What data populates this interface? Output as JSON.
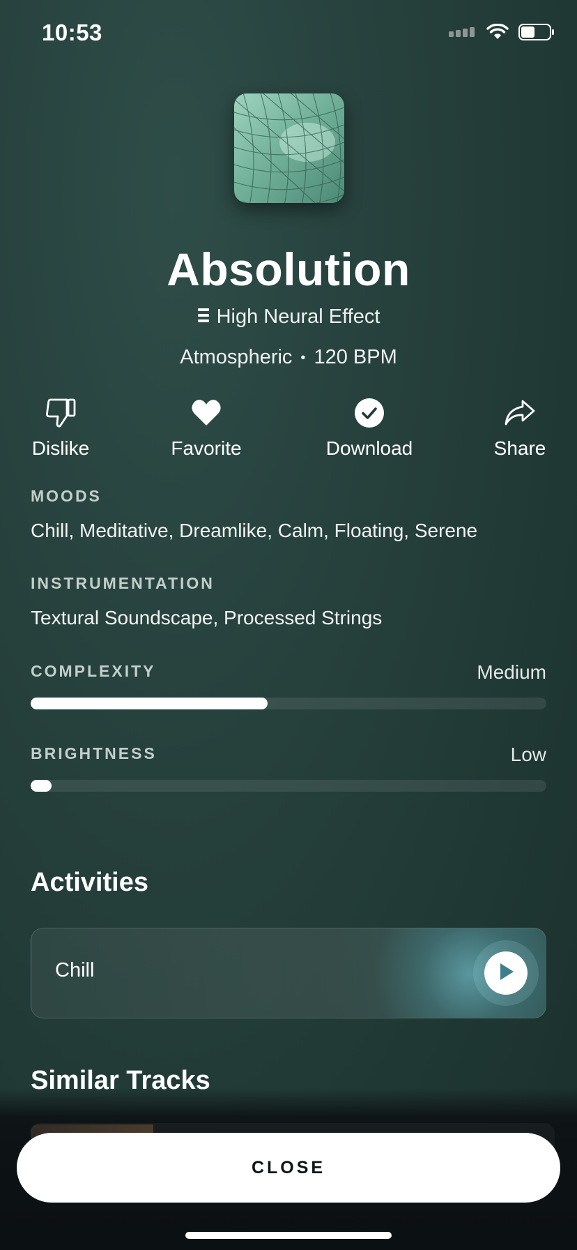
{
  "status_bar": {
    "time": "10:53",
    "icons": [
      "signal-icon",
      "wifi-icon",
      "battery-icon"
    ]
  },
  "track": {
    "artwork": "artwork-image",
    "title": "Absolution",
    "effect_label": "High Neural Effect",
    "genre": "Atmospheric",
    "separator": "•",
    "bpm": "120 BPM"
  },
  "actions": {
    "dislike": "Dislike",
    "favorite": "Favorite",
    "download": "Download",
    "share": "Share"
  },
  "moods": {
    "label": "MOODS",
    "value": "Chill, Meditative, Dreamlike, Calm, Floating, Serene"
  },
  "instrumentation": {
    "label": "INSTRUMENTATION",
    "value": "Textural Soundscape, Processed Strings"
  },
  "complexity": {
    "label": "COMPLEXITY",
    "value": "Medium",
    "level": 0.46
  },
  "brightness": {
    "label": "BRIGHTNESS",
    "value": "Low",
    "level": 0.04
  },
  "activities": {
    "heading": "Activities",
    "items": [
      {
        "label": "Chill"
      }
    ]
  },
  "similar": {
    "heading": "Similar Tracks"
  },
  "close_label": "CLOSE",
  "colors": {
    "background": "#26403c",
    "accent_glow": "#78cddc",
    "button_bg": "#ffffff",
    "button_text": "#101416"
  }
}
